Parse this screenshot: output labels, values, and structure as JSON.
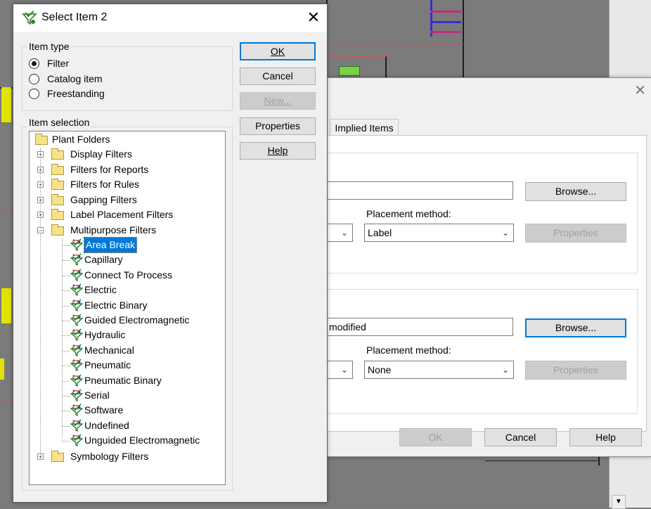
{
  "front_dialog": {
    "title": "Select Item 2",
    "item_type": {
      "legend": "Item type",
      "options": [
        {
          "label": "Filter",
          "checked": true
        },
        {
          "label": "Catalog item",
          "checked": false
        },
        {
          "label": "Freestanding",
          "checked": false
        }
      ]
    },
    "buttons": {
      "ok": "OK",
      "cancel": "Cancel",
      "new": "New...",
      "properties": "Properties",
      "help": "Help"
    },
    "item_selection": {
      "legend": "Item selection",
      "root": "Plant Folders",
      "folders": [
        {
          "label": "Display Filters",
          "expanded": false
        },
        {
          "label": "Filters for Reports",
          "expanded": false
        },
        {
          "label": "Filters for Rules",
          "expanded": false
        },
        {
          "label": "Gapping Filters",
          "expanded": false
        },
        {
          "label": "Label Placement Filters",
          "expanded": false
        },
        {
          "label": "Multipurpose Filters",
          "expanded": true
        }
      ],
      "filters": [
        "Area Break",
        "Capillary",
        "Connect To Process",
        "Electric",
        "Electric Binary",
        "Guided Electromagnetic",
        "Hydraulic",
        "Mechanical",
        "Pneumatic",
        "Pneumatic Binary",
        "Serial",
        "Software",
        "Undefined",
        "Unguided Electromagnetic"
      ],
      "selected_filter": "Area Break",
      "last_folder": {
        "label": "Symbology Filters",
        "expanded": false
      }
    }
  },
  "back_dialog": {
    "tab_label": "Implied Items",
    "group1": {
      "browse_label": "Browse...",
      "placement_label": "Placement method:",
      "placement_value": "Label",
      "properties_label": "Properties"
    },
    "group2": {
      "field_value": "modified",
      "browse_label": "Browse...",
      "placement_label": "Placement method:",
      "placement_value": "None",
      "properties_label": "Properties"
    },
    "buttons": {
      "ok": "OK",
      "cancel": "Cancel",
      "help": "Help"
    }
  },
  "colors": {
    "selection": "#0078d7",
    "default_button_border": "#0078d7",
    "background_canvas": "#7b7b7b"
  }
}
